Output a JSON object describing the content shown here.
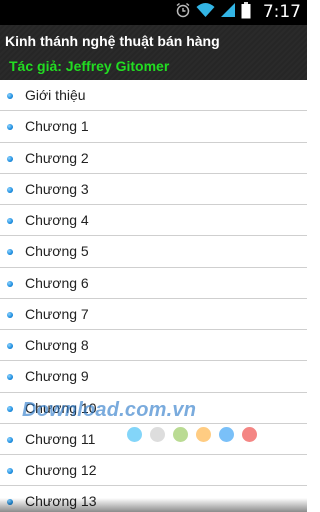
{
  "status_bar": {
    "time": "7:17",
    "icons": [
      "alarm-icon",
      "wifi-icon",
      "signal-icon",
      "battery-icon"
    ]
  },
  "header": {
    "title": "Kinh thánh nghệ thuật bán hàng",
    "author": "Tác giả: Jeffrey Gitomer",
    "author_color": "#22dd22"
  },
  "chapters": [
    "Giới thiệu",
    "Chương 1",
    "Chương 2",
    "Chương 3",
    "Chương 4",
    "Chương 5",
    "Chương 6",
    "Chương 7",
    "Chương 8",
    "Chương 9",
    "Chương 10",
    "Chương 11",
    "Chương 12",
    "Chương 13"
  ],
  "watermark": {
    "text": "Download.com.vn",
    "dot_colors": [
      "#4fc3f7",
      "#cfcfcf",
      "#9ccc65",
      "#ffb74d",
      "#42a5f5",
      "#ef5350"
    ]
  }
}
